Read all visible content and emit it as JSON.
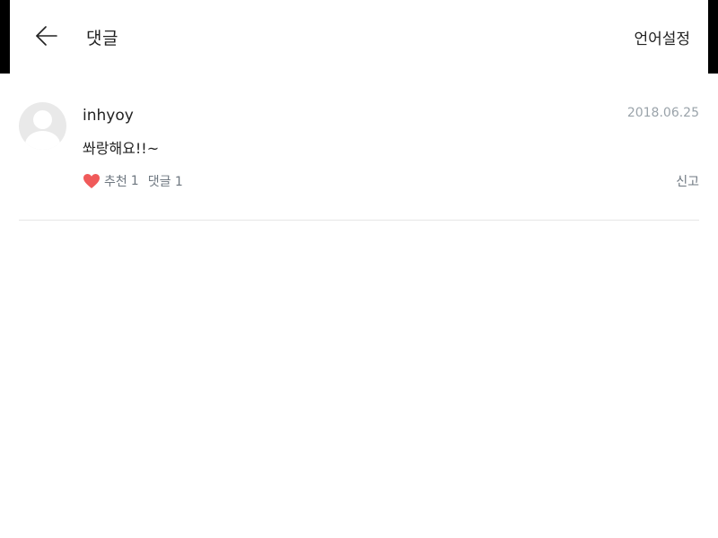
{
  "header": {
    "title": "댓글",
    "language_label": "언어설정"
  },
  "comment": {
    "username": "inhyoy",
    "date": "2018.06.25",
    "text": "쏴랑해요!!~",
    "like_label": "추천",
    "like_count": "1",
    "reply_label": "댓글",
    "reply_count": "1",
    "report_label": "신고"
  },
  "colors": {
    "heart": "#f05a5a",
    "date": "#9aa3aa",
    "meta": "#6e7780"
  }
}
